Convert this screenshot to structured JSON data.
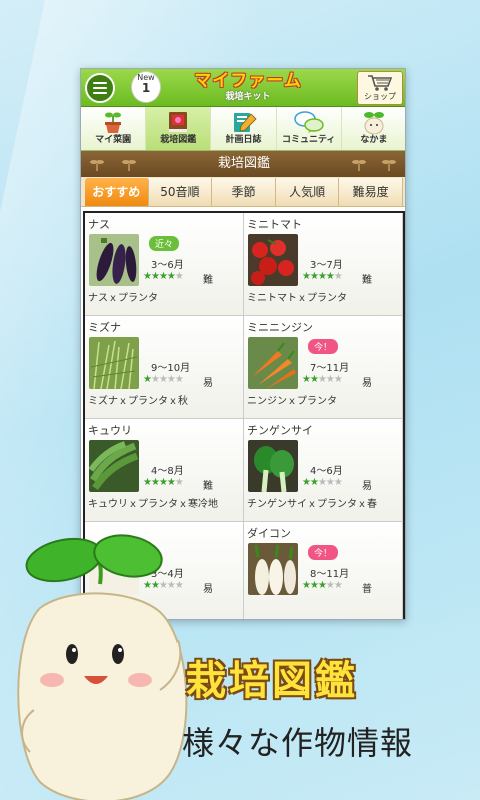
{
  "header": {
    "new_label": "New",
    "new_count": "1",
    "logo_title": "マイファーム",
    "logo_subtitle": "栽培キット",
    "shop_label": "ショップ"
  },
  "nav": [
    {
      "label": "マイ菜園",
      "icon": "potted-sprout-icon"
    },
    {
      "label": "栽培図鑑",
      "icon": "book-icon",
      "active": true
    },
    {
      "label": "計画日誌",
      "icon": "notebook-pencil-icon"
    },
    {
      "label": "コミュニティ",
      "icon": "speech-bubbles-icon"
    },
    {
      "label": "なかま",
      "icon": "mascot-icon"
    }
  ],
  "title": "栽培図鑑",
  "tabs": [
    "おすすめ",
    "50音順",
    "季節",
    "人気順",
    "難易度"
  ],
  "cards": [
    {
      "name": "ナス",
      "badge": "近々",
      "badge_type": "soon",
      "season": "3～6月",
      "stars": 4,
      "difficulty": "難",
      "combo": "ナスｘプランタ",
      "photo": "eggplant"
    },
    {
      "name": "ミニトマト",
      "badge": "",
      "badge_type": "",
      "season": "3～7月",
      "stars": 4,
      "difficulty": "難",
      "combo": "ミニトマトｘプランタ",
      "photo": "tomato"
    },
    {
      "name": "ミズナ",
      "badge": "",
      "badge_type": "",
      "season": "9～10月",
      "stars": 1,
      "difficulty": "易",
      "combo": "ミズナｘプランタｘ秋",
      "photo": "mizuna"
    },
    {
      "name": "ミニニンジン",
      "badge": "今！",
      "badge_type": "now",
      "season": "7～11月",
      "stars": 2,
      "difficulty": "易",
      "combo": "ニンジンｘプランタ",
      "photo": "carrot"
    },
    {
      "name": "キュウリ",
      "badge": "",
      "badge_type": "",
      "season": "4～8月",
      "stars": 4,
      "difficulty": "難",
      "combo": "キュウリｘプランタｘ寒冷地",
      "photo": "cucumber"
    },
    {
      "name": "チンゲンサイ",
      "badge": "",
      "badge_type": "",
      "season": "4～6月",
      "stars": 2,
      "difficulty": "易",
      "combo": "チンゲンサイｘプランタｘ春",
      "photo": "bokchoy"
    },
    {
      "name": "",
      "badge": "",
      "badge_type": "",
      "season": "3～4月",
      "stars": 2,
      "difficulty": "易",
      "combo": "",
      "photo": "hidden"
    },
    {
      "name": "ダイコン",
      "badge": "今！",
      "badge_type": "now",
      "season": "8～11月",
      "stars": 3,
      "difficulty": "普",
      "combo": "",
      "photo": "daikon"
    }
  ],
  "caption": {
    "title": "栽培図鑑",
    "subtitle": "様々な作物情報"
  },
  "colors": {
    "header_green": "#6cbb22",
    "title_brown": "#6b4a22",
    "tab_active_orange": "#f08a10",
    "star_green": "#3ca02c",
    "badge_soon": "#6cbf3a",
    "badge_now": "#f05585",
    "caption_yellow": "#ffe23a"
  }
}
